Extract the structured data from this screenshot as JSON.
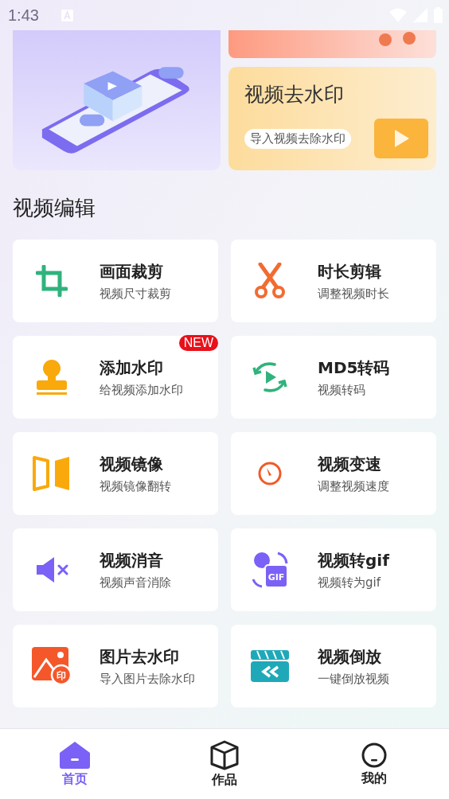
{
  "status_bar": {
    "time": "1:43"
  },
  "banner": {
    "title": "视频去水印",
    "subtitle": "导入视频去除水印"
  },
  "section_title": "视频编辑",
  "tools": [
    {
      "title": "画面裁剪",
      "subtitle": "视频尺寸裁剪"
    },
    {
      "title": "时长剪辑",
      "subtitle": "调整视频时长"
    },
    {
      "title": "添加水印",
      "subtitle": "给视频添加水印",
      "badge": "NEW"
    },
    {
      "title": "MD5转码",
      "subtitle": "视频转码"
    },
    {
      "title": "视频镜像",
      "subtitle": "视频镜像翻转"
    },
    {
      "title": "视频变速",
      "subtitle": "调整视频速度"
    },
    {
      "title": "视频消音",
      "subtitle": "视频声音消除"
    },
    {
      "title": "视频转gif",
      "subtitle": "视频转为gif",
      "icon_text": "GIF"
    },
    {
      "title": "图片去水印",
      "subtitle": "导入图片去除水印",
      "icon_text": "印"
    },
    {
      "title": "视频倒放",
      "subtitle": "一键倒放视频"
    }
  ],
  "tabs": [
    {
      "label": "首页",
      "selected": true
    },
    {
      "label": "作品",
      "selected": false
    },
    {
      "label": "我的",
      "selected": false
    }
  ]
}
